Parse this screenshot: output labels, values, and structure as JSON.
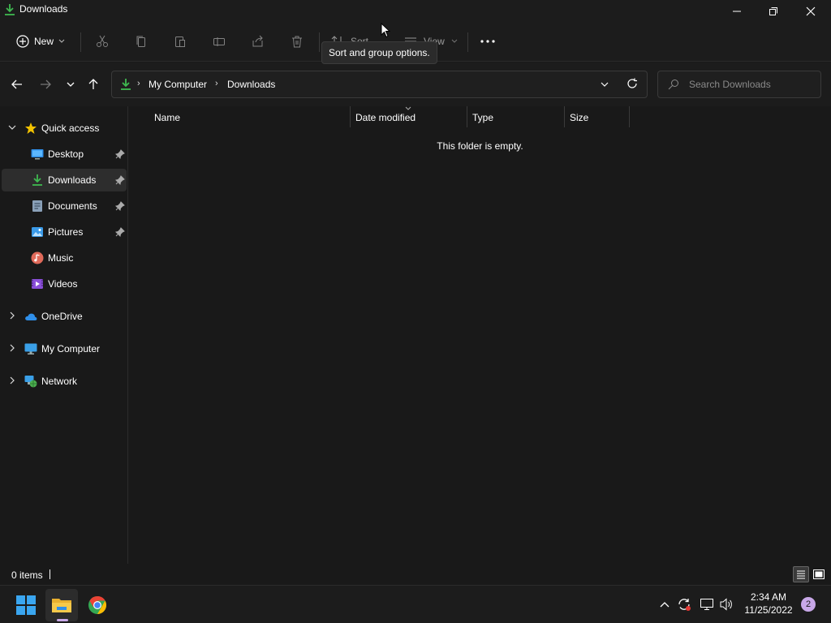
{
  "window": {
    "title": "Downloads"
  },
  "commandbar": {
    "new_label": "New",
    "sort_label": "Sort",
    "view_label": "View",
    "tooltip": "Sort and group options."
  },
  "address": {
    "crumbs": [
      "My Computer",
      "Downloads"
    ]
  },
  "search": {
    "placeholder": "Search Downloads"
  },
  "sidebar": {
    "items": [
      {
        "label": "Quick access"
      },
      {
        "label": "Desktop"
      },
      {
        "label": "Downloads"
      },
      {
        "label": "Documents"
      },
      {
        "label": "Pictures"
      },
      {
        "label": "Music"
      },
      {
        "label": "Videos"
      },
      {
        "label": "OneDrive"
      },
      {
        "label": "My Computer"
      },
      {
        "label": "Network"
      }
    ]
  },
  "columns": [
    "Name",
    "Date modified",
    "Type",
    "Size"
  ],
  "content": {
    "empty_message": "This folder is empty."
  },
  "status": {
    "item_count": "0 items"
  },
  "taskbar": {
    "time": "2:34 AM",
    "date": "11/25/2022",
    "notification_count": "2"
  },
  "colors": {
    "accent_green": "#3fb950",
    "star": "#f2c200",
    "onedrive": "#2f8fea",
    "badge": "#c8a8e8"
  }
}
